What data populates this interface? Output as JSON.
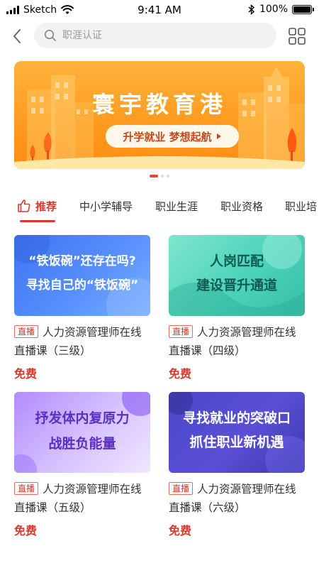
{
  "status_bar": {
    "carrier": "Sketch",
    "time": "9:41 AM",
    "battery": "100%",
    "battery_level": 1.0
  },
  "header": {
    "search_placeholder": "职涯认证"
  },
  "banner": {
    "title": "寰宇教育港",
    "cta": "升学就业 梦想起航",
    "dots_count": 3,
    "active_dot": 0
  },
  "tabs": [
    {
      "label": "推荐",
      "active": true
    },
    {
      "label": "中小学辅导"
    },
    {
      "label": "职业生涯"
    },
    {
      "label": "职业资格"
    },
    {
      "label": "职业培"
    }
  ],
  "courses": [
    {
      "thumb_lines": [
        "“铁饭碗”还存在吗?",
        "寻找自己的“铁饭碗”"
      ],
      "tag": "直播",
      "title": "人力资源管理师在线直播课（三级）",
      "price": "免费",
      "theme": "blue"
    },
    {
      "thumb_lines": [
        "人岗匹配",
        "建设晋升通道"
      ],
      "tag": "直播",
      "title": "人力资源管理师在线直播课（四级）",
      "price": "免费",
      "theme": "teal"
    },
    {
      "thumb_lines": [
        "抒发体内复原力",
        "战胜负能量"
      ],
      "tag": "直播",
      "title": "人力资源管理师在线直播课（五级）",
      "price": "免费",
      "theme": "purple"
    },
    {
      "thumb_lines": [
        "寻找就业的突破口",
        "抓住职业新机遇"
      ],
      "tag": "直播",
      "title": "人力资源管理师在线直播课（六级）",
      "price": "免费",
      "theme": "indigo"
    }
  ],
  "colors": {
    "accent": "#d9392c",
    "banner": "#ff9a1f"
  }
}
